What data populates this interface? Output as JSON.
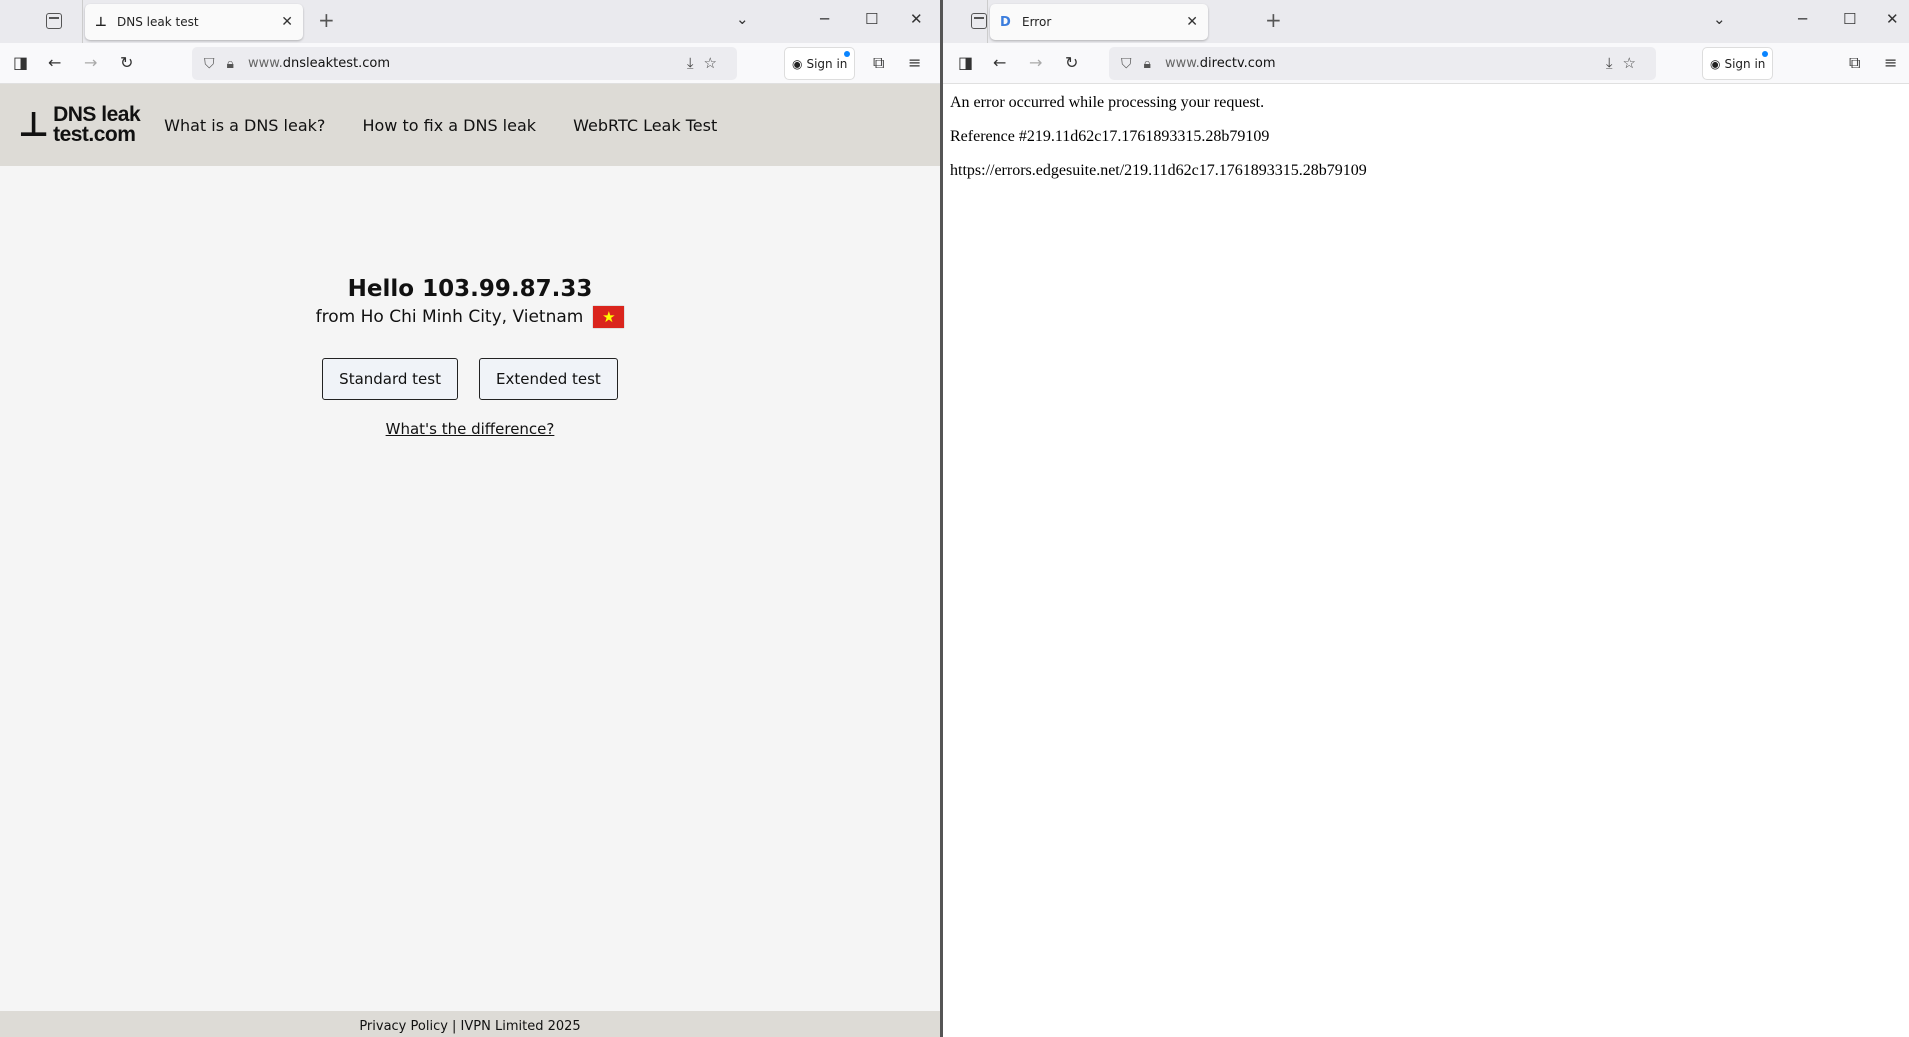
{
  "left": {
    "tab": {
      "title": "DNS leak test"
    },
    "url": {
      "prefix": "www.",
      "host": "dnsleaktest.com"
    },
    "signin": "Sign in",
    "site": {
      "logo_line1": "DNS leak",
      "logo_line2": "test.com",
      "nav": [
        "What is a DNS leak?",
        "How to fix a DNS leak",
        "WebRTC Leak Test"
      ],
      "hello": "Hello 103.99.87.33",
      "from": "from Ho Chi Minh City, Vietnam",
      "buttons": [
        "Standard test",
        "Extended test"
      ],
      "diff_link": "What's the difference?",
      "footer": "Privacy Policy | IVPN Limited 2025"
    }
  },
  "right": {
    "tab": {
      "title": "Error",
      "favicon": "D"
    },
    "url": {
      "prefix": "www.",
      "host": "directv.com"
    },
    "signin": "Sign in",
    "lines": [
      "An error occurred while processing your request.",
      "Reference #219.11d62c17.1761893315.28b79109",
      "https://errors.edgesuite.net/219.11d62c17.1761893315.28b79109"
    ]
  }
}
